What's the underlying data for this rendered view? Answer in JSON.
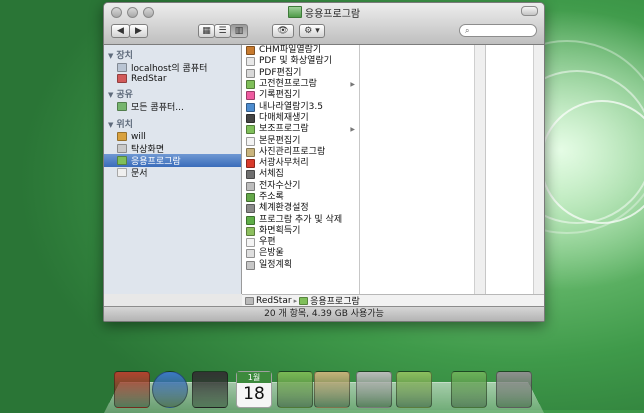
{
  "window": {
    "title": "응용프로그람"
  },
  "toolbar": {
    "back_label": "◀",
    "forward_label": "▶",
    "view_icon_label": "▦",
    "view_list_label": "☰",
    "view_column_label": "▥",
    "quicklook_label": "👁",
    "action_label": "⚙ ▾",
    "search_placeholder": ""
  },
  "sidebar": {
    "sections": [
      {
        "label": "장치",
        "items": [
          "localhost의 콤퓨터",
          "RedStar"
        ]
      },
      {
        "label": "공유",
        "items": [
          "모든 콤퓨터..."
        ]
      },
      {
        "label": "위치",
        "items": [
          "will",
          "탁상화면",
          "응용프로그람",
          "문서"
        ]
      }
    ],
    "selected": "응용프로그람"
  },
  "files": [
    {
      "name": "CHM파일열람기",
      "icon": "book",
      "color": "#c77a2e",
      "folder": false
    },
    {
      "name": "PDF 및 화상열람기",
      "icon": "doc",
      "color": "#e8e8e8",
      "folder": false
    },
    {
      "name": "PDF편집기",
      "icon": "doc",
      "color": "#d9d9d9",
      "folder": false
    },
    {
      "name": "고전현프로그람",
      "icon": "folder",
      "color": "#7fbf5a",
      "folder": true
    },
    {
      "name": "기록편집기",
      "icon": "pen",
      "color": "#ef5ba0",
      "folder": false
    },
    {
      "name": "내나라열람기3.5",
      "icon": "globe",
      "color": "#4d8ccf",
      "folder": false
    },
    {
      "name": "다매체재생기",
      "icon": "film",
      "color": "#444444",
      "folder": false
    },
    {
      "name": "보조프로그람",
      "icon": "folder",
      "color": "#7fbf5a",
      "folder": true
    },
    {
      "name": "본문편집기",
      "icon": "doc",
      "color": "#f3f3f3",
      "folder": false
    },
    {
      "name": "사진관리프로그람",
      "icon": "photo",
      "color": "#c9b47d",
      "folder": false
    },
    {
      "name": "서광사무처리",
      "icon": "office",
      "color": "#d83a2b",
      "folder": false
    },
    {
      "name": "서체집",
      "icon": "font",
      "color": "#6f6f6f",
      "folder": false
    },
    {
      "name": "전자수산기",
      "icon": "calc",
      "color": "#bdbdbd",
      "folder": false
    },
    {
      "name": "주소록",
      "icon": "book",
      "color": "#65a84a",
      "folder": false
    },
    {
      "name": "체계환경설정",
      "icon": "gear",
      "color": "#8a8a8a",
      "folder": false
    },
    {
      "name": "프로그람 추가 및 삭제",
      "icon": "box",
      "color": "#5fae48",
      "folder": false
    },
    {
      "name": "화면획득기",
      "icon": "camera",
      "color": "#8dbf5f",
      "folder": false
    },
    {
      "name": "우편",
      "icon": "mail",
      "color": "#f4f4f4",
      "folder": false
    },
    {
      "name": "은방울",
      "icon": "bell",
      "color": "#dedede",
      "folder": false
    },
    {
      "name": "일정계획",
      "icon": "calendar",
      "color": "#c7c7c7",
      "folder": false
    }
  ],
  "pathbar": {
    "items": [
      "RedStar",
      "응용프로그람"
    ],
    "separator": "▸"
  },
  "status": {
    "text": "20 개 항목, 4.39 GB 사용가능"
  },
  "dock": {
    "items": [
      {
        "name": "bookmark",
        "color": "#b3432f"
      },
      {
        "name": "globe",
        "color": "#3d79c7"
      },
      {
        "name": "media-player",
        "color": "#333333"
      },
      {
        "name": "calendar",
        "color": "#f2f2f2"
      },
      {
        "name": "address-book",
        "color": "#7bb956"
      },
      {
        "name": "photo-manager",
        "color": "#c7b27a"
      },
      {
        "name": "calculator",
        "color": "#bbbbbb"
      },
      {
        "name": "screenshot",
        "color": "#8dbf5f"
      },
      {
        "name": "installer",
        "color": "#6db25a"
      },
      {
        "name": "trash",
        "color": "#8f8f8f"
      }
    ],
    "calendar_month": "1월",
    "calendar_day": "18"
  }
}
